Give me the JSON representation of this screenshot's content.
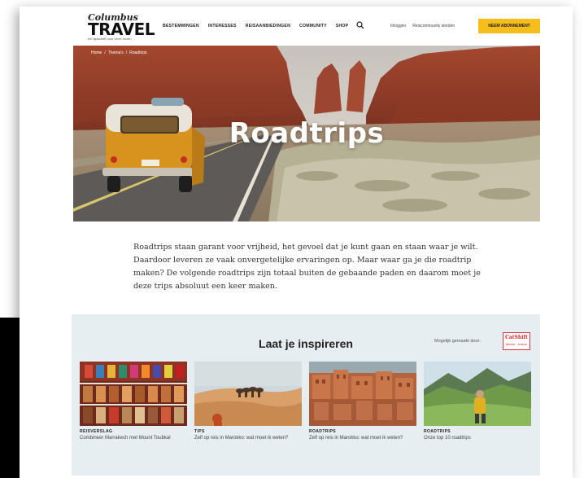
{
  "logo": {
    "top": "Columbus",
    "main": "TRAVEL",
    "sub": "het tijdschrift voor verre reizen"
  },
  "nav": [
    "BESTEMMINGEN",
    "INTERESSES",
    "REISAANBIEDINGEN",
    "COMMUNITY",
    "SHOP"
  ],
  "util_links": [
    "Inloggen",
    "Reiscommunity worden"
  ],
  "cta_label": "NEEM ABONNEMENT",
  "breadcrumb": [
    "Home",
    "/",
    "Thema's",
    "/",
    "Roadtrips"
  ],
  "hero_title": "Roadtrips",
  "intro_text": "Roadtrips staan garant voor vrijheid, het gevoel dat je kunt gaan en staan waar je wilt. Daardoor leveren ze vaak onvergetelijke ervaringen op. Maar waar ga je die roadtrip maken? De volgende roadtrips zijn totaal buiten de gebaande paden en daarom moet je deze trips absoluut een keer maken.",
  "inspire": {
    "title": "Laat je inspireren",
    "sponsor_label": "Mogelijk gemaakt door:",
    "sponsor_logo": "CatShift",
    "sponsor_logo_sub": "kiezen · reizen",
    "cards": [
      {
        "category": "REISVERSLAG",
        "title": "Combineer Marrakech met Mount Toubkal"
      },
      {
        "category": "TIPS",
        "title": "Zelf op reis in Marokko: wat moet ik weten?"
      },
      {
        "category": "ROADTRIPS",
        "title": "Zelf op reis in Marokko: wat moet ik weten?"
      },
      {
        "category": "ROADTRIPS",
        "title": "Onze top 10 roadtrips"
      }
    ]
  },
  "colors": {
    "accent": "#f6be1c",
    "section_bg": "#e6eef1"
  }
}
